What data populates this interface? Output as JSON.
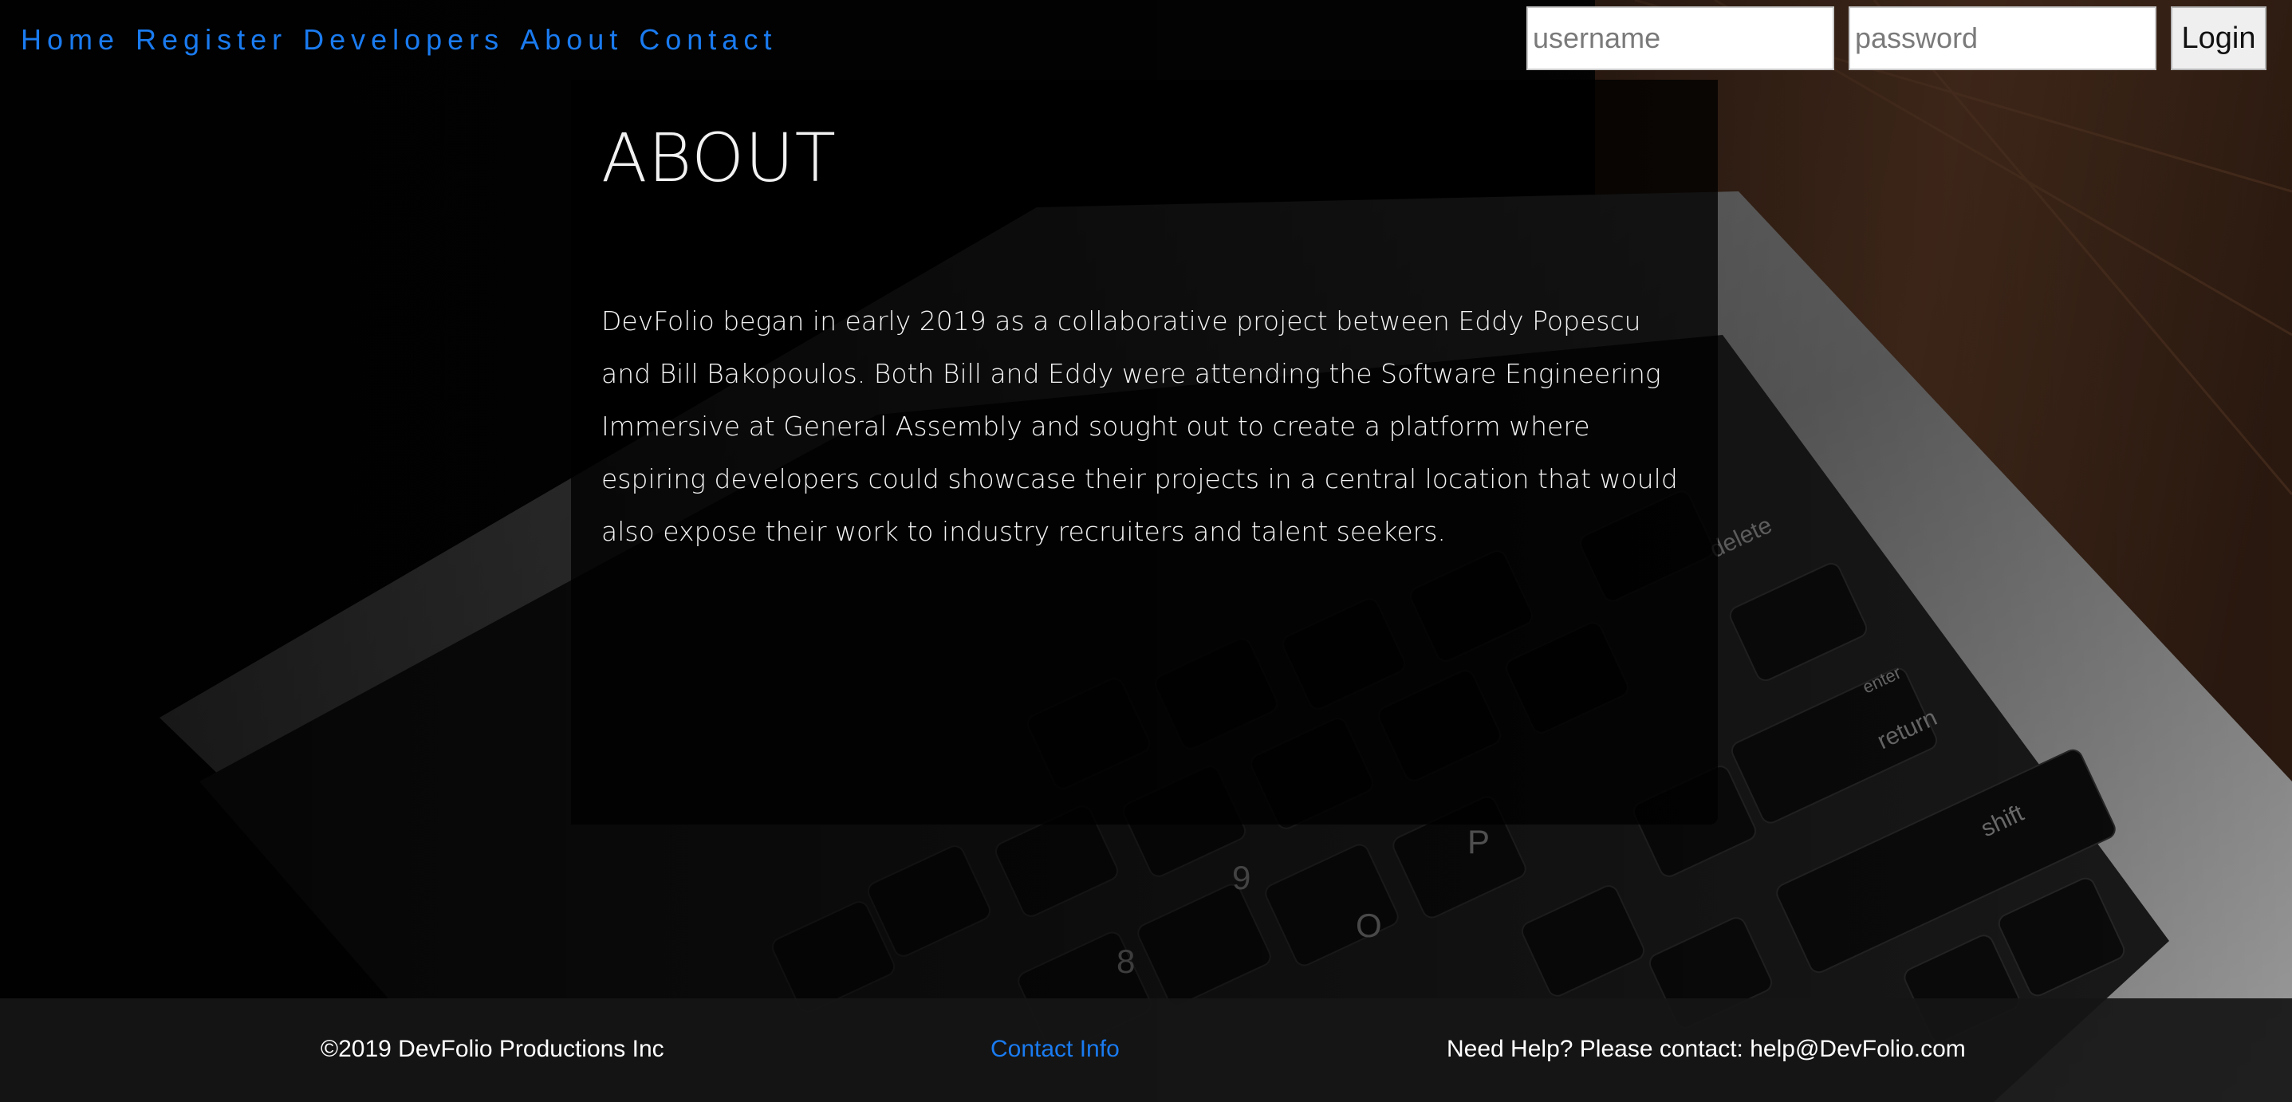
{
  "nav": {
    "links": [
      "Home",
      "Register",
      "Developers",
      "About",
      "Contact"
    ],
    "username_placeholder": "username",
    "password_placeholder": "password",
    "login_label": "Login",
    "link_color": "#1a7bf0"
  },
  "about": {
    "title": "ABOUT",
    "body": "DevFolio began in early 2019 as a collaborative project between Eddy Popescu and Bill Bakopoulos. Both Bill and Eddy were attending the Software Engineering Immersive at General Assembly and sought out to create a platform where espiring developers could showcase their projects in a central location that would also expose their work to industry recruiters and talent seekers."
  },
  "footer": {
    "copyright": "©2019 DevFolio Productions Inc",
    "contact_link": "Contact Info",
    "help": "Need Help? Please contact: help@DevFolio.com"
  },
  "background": {
    "image": "laptop-keyboard-photo",
    "keys": [
      "delete",
      "enter",
      "return",
      "shift",
      "P",
      "O",
      "9",
      "8"
    ]
  }
}
